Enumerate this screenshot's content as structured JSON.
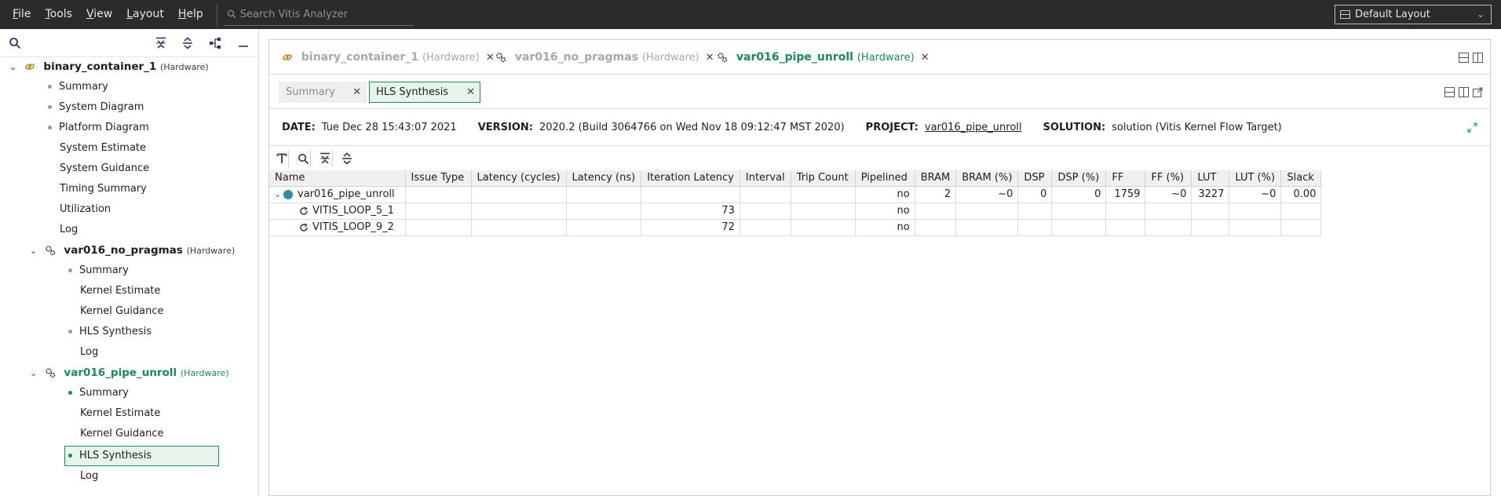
{
  "menubar": {
    "items": [
      {
        "mn": "F",
        "rest": "ile"
      },
      {
        "mn": "T",
        "rest": "ools"
      },
      {
        "mn": "V",
        "rest": "iew"
      },
      {
        "mn": "L",
        "rest": "ayout"
      },
      {
        "mn": "H",
        "rest": "elp"
      }
    ],
    "search_placeholder": "Search Vitis Analyzer",
    "layout_value": "Default Layout"
  },
  "tree": {
    "root": {
      "name": "binary_container_1",
      "tag": "(Hardware)"
    },
    "root_items": [
      "Summary",
      "System Diagram",
      "Platform Diagram",
      "System Estimate",
      "System Guidance",
      "Timing Summary",
      "Utilization",
      "Log"
    ],
    "kernel1": {
      "name": "var016_no_pragmas",
      "tag": "(Hardware)"
    },
    "kernel1_items": [
      "Summary",
      "Kernel Estimate",
      "Kernel Guidance",
      "HLS Synthesis",
      "Log"
    ],
    "kernel2": {
      "name": "var016_pipe_unroll",
      "tag": "(Hardware)"
    },
    "kernel2_items": [
      "Summary",
      "Kernel Estimate",
      "Kernel Guidance",
      "HLS Synthesis",
      "Log"
    ]
  },
  "editor_tabs": [
    {
      "name": "binary_container_1",
      "tag": "(Hardware)"
    },
    {
      "name": "var016_no_pragmas",
      "tag": "(Hardware)"
    },
    {
      "name": "var016_pipe_unroll",
      "tag": "(Hardware)"
    }
  ],
  "sub_tabs": [
    "Summary",
    "HLS Synthesis"
  ],
  "info": {
    "date_label": "DATE:",
    "date": "Tue Dec 28 15:43:07 2021",
    "version_label": "VERSION:",
    "version": "2020.2 (Build 3064766 on Wed Nov 18 09:12:47 MST 2020)",
    "project_label": "PROJECT:",
    "project": "var016_pipe_unroll",
    "solution_label": "SOLUTION:",
    "solution": "solution (Vitis Kernel Flow Target)"
  },
  "table": {
    "headers": [
      "Name",
      "Issue Type",
      "Latency (cycles)",
      "Latency (ns)",
      "Iteration Latency",
      "Interval",
      "Trip Count",
      "Pipelined",
      "BRAM",
      "BRAM (%)",
      "DSP",
      "DSP (%)",
      "FF",
      "FF (%)",
      "LUT",
      "LUT (%)",
      "Slack"
    ],
    "rows": [
      [
        "var016_pipe_unroll",
        "",
        "",
        "",
        "",
        "",
        "",
        "no",
        "2",
        "~0",
        "0",
        "0",
        "1759",
        "~0",
        "3227",
        "~0",
        "0.00"
      ],
      [
        "VITIS_LOOP_5_1",
        "",
        "",
        "",
        "73",
        "",
        "",
        "no",
        "",
        "",
        "",
        "",
        "",
        "",
        "",
        "",
        ""
      ],
      [
        "VITIS_LOOP_9_2",
        "",
        "",
        "",
        "72",
        "",
        "",
        "no",
        "",
        "",
        "",
        "",
        "",
        "",
        "",
        "",
        ""
      ]
    ]
  },
  "colors": {
    "accent": "#1b8a5a",
    "menubar": "#2b2b2b",
    "module_dot": "#2f8ca6"
  }
}
